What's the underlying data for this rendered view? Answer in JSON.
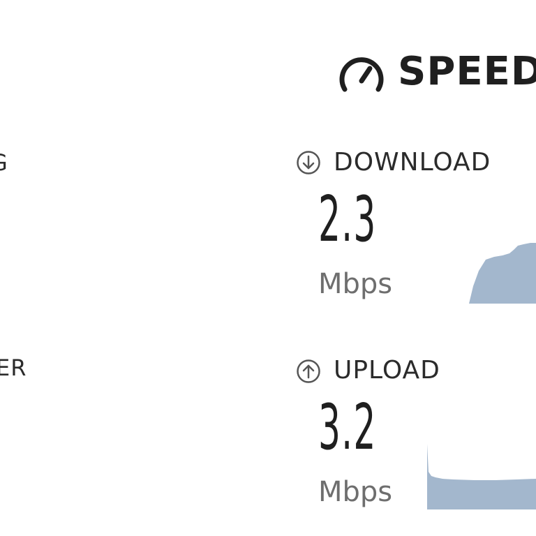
{
  "left_fragments": {
    "top": "G",
    "bottom": "ER"
  },
  "header": {
    "logo_text": "SPEED",
    "logo_icon": "speedometer-icon"
  },
  "download": {
    "label": "DOWNLOAD",
    "icon": "arrow-down-circle-icon",
    "value": "2.3",
    "unit": "Mbps"
  },
  "upload": {
    "label": "UPLOAD",
    "icon": "arrow-up-circle-icon",
    "value": "3.2",
    "unit": "Mbps"
  },
  "colors": {
    "graph_fill": "#a3b7cd",
    "text_dark": "#1f1f1f",
    "text_muted": "#6e6e6e"
  }
}
